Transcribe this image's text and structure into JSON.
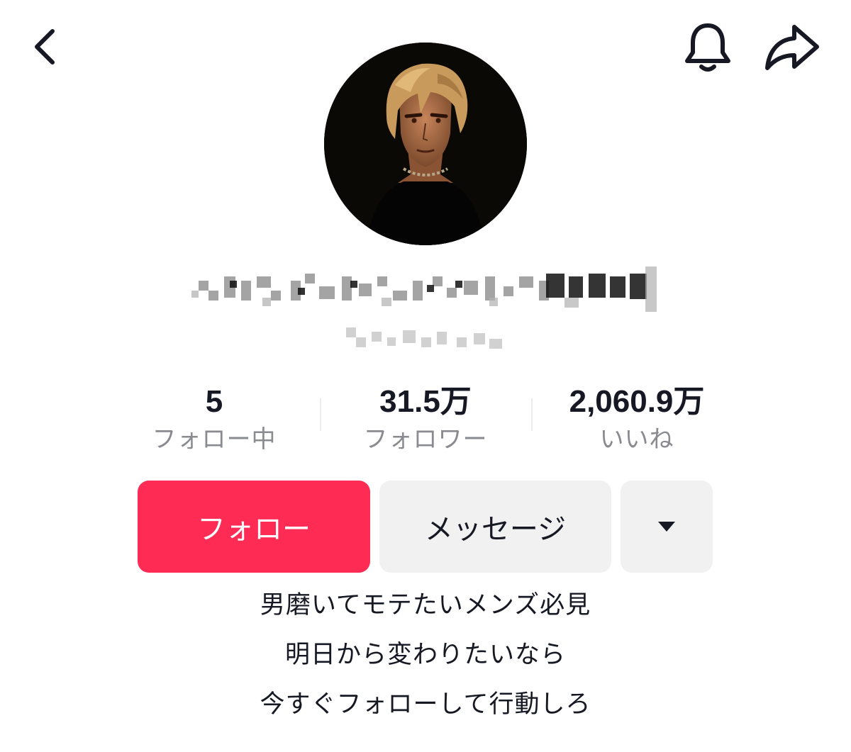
{
  "header": {
    "back_icon": "chevron-left-icon",
    "bell_icon": "bell-icon",
    "share_icon": "share-arrow-icon"
  },
  "profile": {
    "avatar_description": "anime-style portrait avatar",
    "name_censored": true,
    "handle_censored": true
  },
  "stats": {
    "following_value": "5",
    "following_label": "フォロー中",
    "followers_value": "31.5万",
    "followers_label": "フォロワー",
    "likes_value": "2,060.9万",
    "likes_label": "いいね"
  },
  "actions": {
    "follow_label": "フォロー",
    "message_label": "メッセージ",
    "more_icon": "caret-down-icon"
  },
  "bio": {
    "lines": [
      "男磨いてモテたいメンズ必見",
      "明日から変わりたいなら",
      "今すぐフォローして行動しろ"
    ]
  },
  "colors": {
    "accent": "#fe2c55",
    "button_gray": "#f1f1f2",
    "text_primary": "#161823",
    "text_secondary": "#8a8b91"
  }
}
